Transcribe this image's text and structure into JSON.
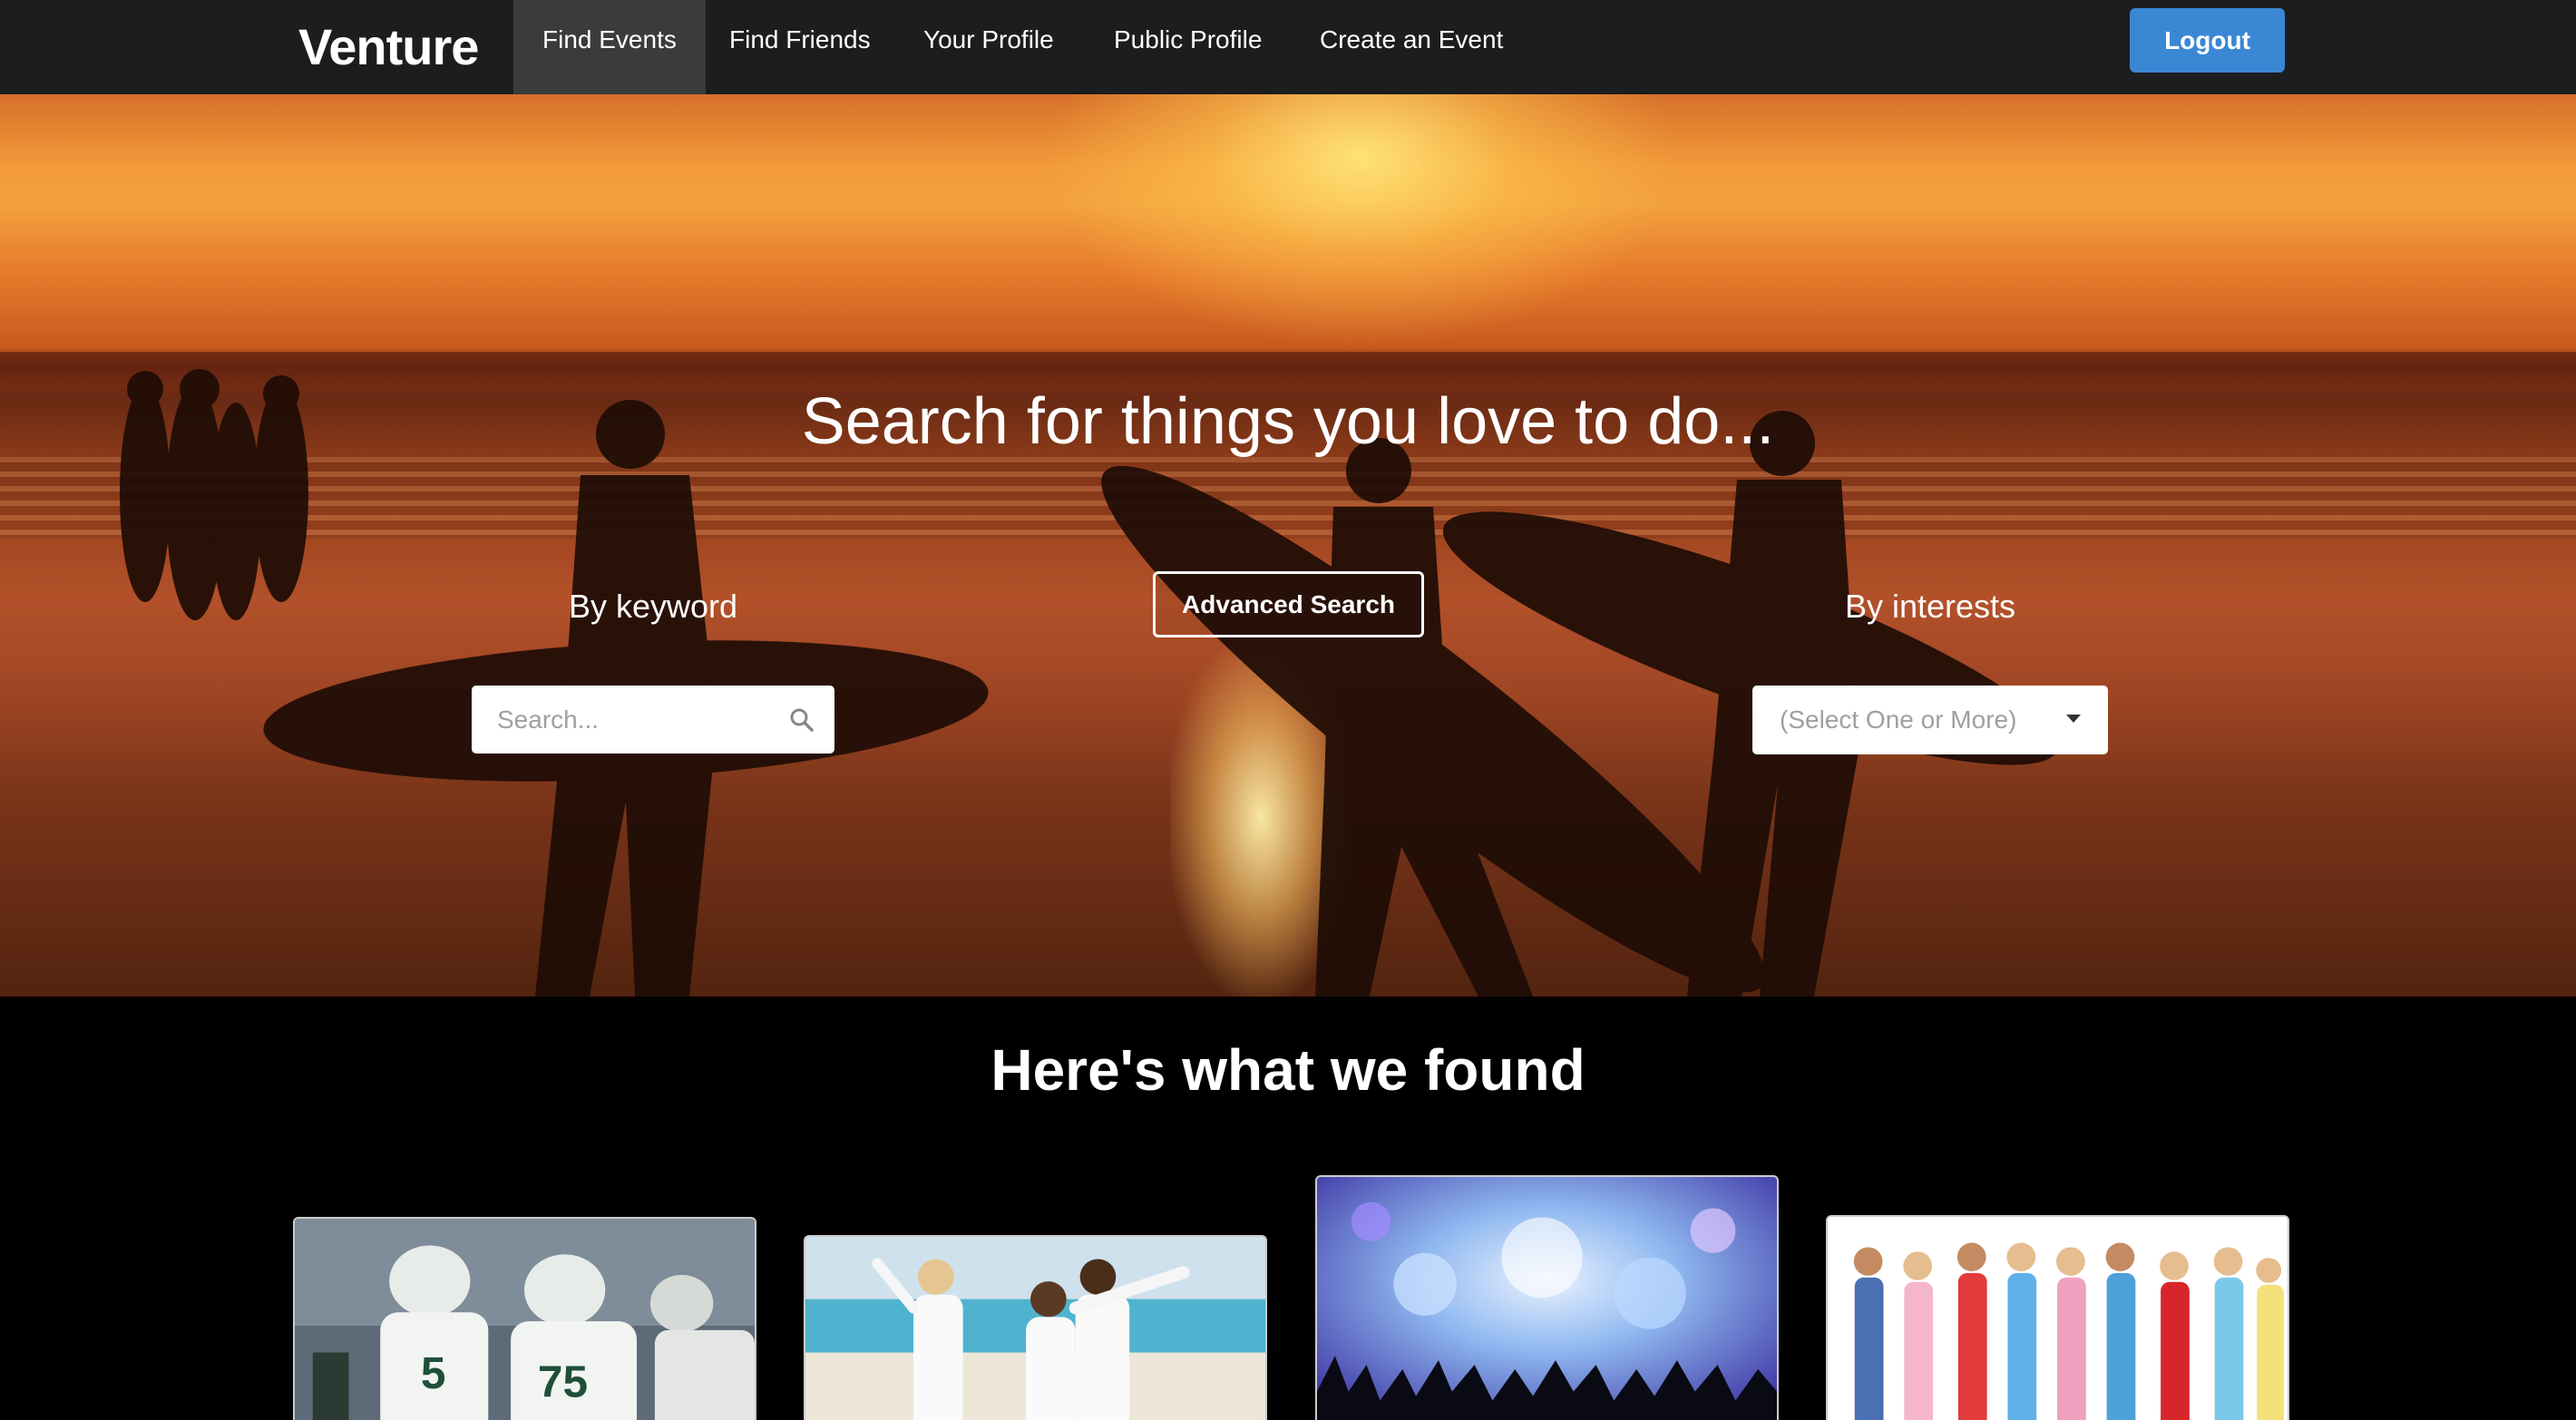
{
  "navbar": {
    "brand": "Venture",
    "items": [
      {
        "label": "Find Events",
        "active": true
      },
      {
        "label": "Find Friends",
        "active": false
      },
      {
        "label": "Your Profile",
        "active": false
      },
      {
        "label": "Public Profile",
        "active": false
      },
      {
        "label": "Create an Event",
        "active": false
      }
    ],
    "logout_label": "Logout"
  },
  "hero": {
    "title": "Search for things you love to do...",
    "keyword_label": "By keyword",
    "search_placeholder": "Search...",
    "advanced_search_label": "Advanced Search",
    "interests_label": "By interests",
    "interests_placeholder": "(Select One or More)"
  },
  "results": {
    "title": "Here's what we found",
    "cards": [
      {
        "image": "football-players-photo"
      },
      {
        "image": "beach-friends-photo"
      },
      {
        "image": "concert-crowd-photo"
      },
      {
        "image": "pajama-group-photo"
      }
    ]
  },
  "colors": {
    "navbar_bg": "#1c1d1f",
    "active_tab_bg": "#3a3b3d",
    "logout_bg": "#3a87d4"
  }
}
